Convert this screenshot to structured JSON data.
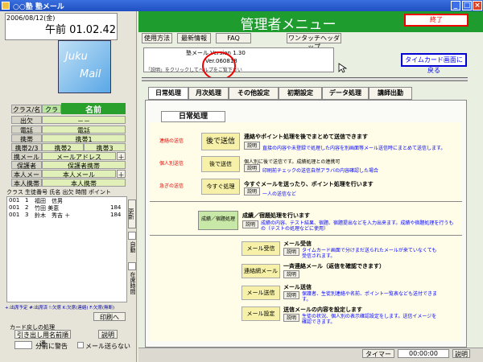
{
  "window": {
    "title": "○○塾 塾メール"
  },
  "left": {
    "date": "2006/08/12(金)",
    "time": "午前 01.02.42",
    "logo_line1": "Juku",
    "logo_line2": "Mail",
    "class_label": "クラス/名前",
    "class_value": "クラス",
    "name_value": "名前",
    "rows": [
      {
        "label": "出欠",
        "value": "－－"
      },
      {
        "label": "電話",
        "value": "電話"
      },
      {
        "label": "携帯",
        "value": "携帯1"
      },
      {
        "label": "携帯2/3",
        "value": "携帯2",
        "value2": "携帯3"
      },
      {
        "label": "携メール",
        "value": "メールアドレス"
      },
      {
        "label": "保護者",
        "value": "保護者携帯"
      },
      {
        "label": "本人メール",
        "value": "本人メール"
      },
      {
        "label": "本人携帯",
        "value": "本人携帯"
      }
    ],
    "list_header": "クラス 生徒番号 氏名  出欠 時間  ポイント",
    "students": [
      {
        "cls": "001",
        "no": "1",
        "name": "福田　信男",
        "pt": ""
      },
      {
        "cls": "001",
        "no": "2",
        "name": "竹田 美恵",
        "pt": "184"
      },
      {
        "cls": "001",
        "no": "3",
        "name": "鈴木　秀吉 ＋",
        "pt": "184"
      }
    ],
    "side_tabs": [
      "更新",
      "自動",
      "在席時間"
    ],
    "legend": "+:出席予定 #:出席済 !:欠席 K:欠席(連絡) F:欠席(無断)",
    "print_button": "印刷へ",
    "card_group_label": "カード戻しの処理",
    "card_button": "引き出し用名前順通",
    "explain": "説明",
    "minutes_label": "分前に警告",
    "mail_checkbox": "メール送らない"
  },
  "header": {
    "title": "管理者メニュー",
    "exit": "終了",
    "toolbar": [
      "使用方法",
      "最新情報",
      "FAQ",
      "ワンタッチヘッダップ"
    ]
  },
  "version": {
    "line1": "塾メール Version 1.30",
    "line2": "Ver.060818",
    "line3": "「説明」をクリックしてヘルプをご覧下さい"
  },
  "timecard_button": "タイムカード画面に戻る",
  "tabs": [
    "日常処理",
    "月次処理",
    "その他設定",
    "初期設定",
    "データ処理",
    "講師出勤"
  ],
  "section_title": "日常処理",
  "items": [
    {
      "red": "連絡の送信",
      "button": "後で送信",
      "title": "連絡やポイント処理を後でまとめて送信できます",
      "desc": "直接の内容や未登録で処理した内容を別画面等メール送信時にまとめて送信します。"
    },
    {
      "red": "個人別送信",
      "button": "後で送信",
      "title": "個人別に後で送信です。成績処理との連携可",
      "desc": "印刷前チェックの送信自然アラバの内容確認した場合"
    },
    {
      "red": "急ぎの送信",
      "button": "今すぐ処理",
      "title": "今すぐメールを送ったり、ポイント処理を行います",
      "desc": "一人の送信など"
    },
    {
      "red": "",
      "button": "成績／宿題処理",
      "title": "成績／宿題処理を行います",
      "desc": "成績の内容、テスト結果、宿題、宿題提出などを入力出来ます。成績や宿題処理を行うもの（テストの処理などに使用）"
    },
    {
      "red": "",
      "button": "メール受信",
      "title": "メール受信",
      "desc": "タイムカード画面で分けまだ送られたメールが来ていなくても受信されます。"
    },
    {
      "red": "",
      "button": "連絡網メール",
      "title": "一斉連絡メール（返信を確認できます）",
      "desc": ""
    },
    {
      "red": "",
      "button": "メール送信",
      "title": "メール送信",
      "desc": "保護者、生徒別連絡や名前、ポイント一覧表なども送付できます。"
    },
    {
      "red": "",
      "button": "メール設定",
      "title": "送信メールの内容を設定します",
      "desc": "生徒の状況、個人別の表示確認設定をします。送信イメージを確認できます。"
    }
  ],
  "status": {
    "timer_label": "タイマー",
    "timer_value": "00:00:00",
    "explain": "説明"
  }
}
